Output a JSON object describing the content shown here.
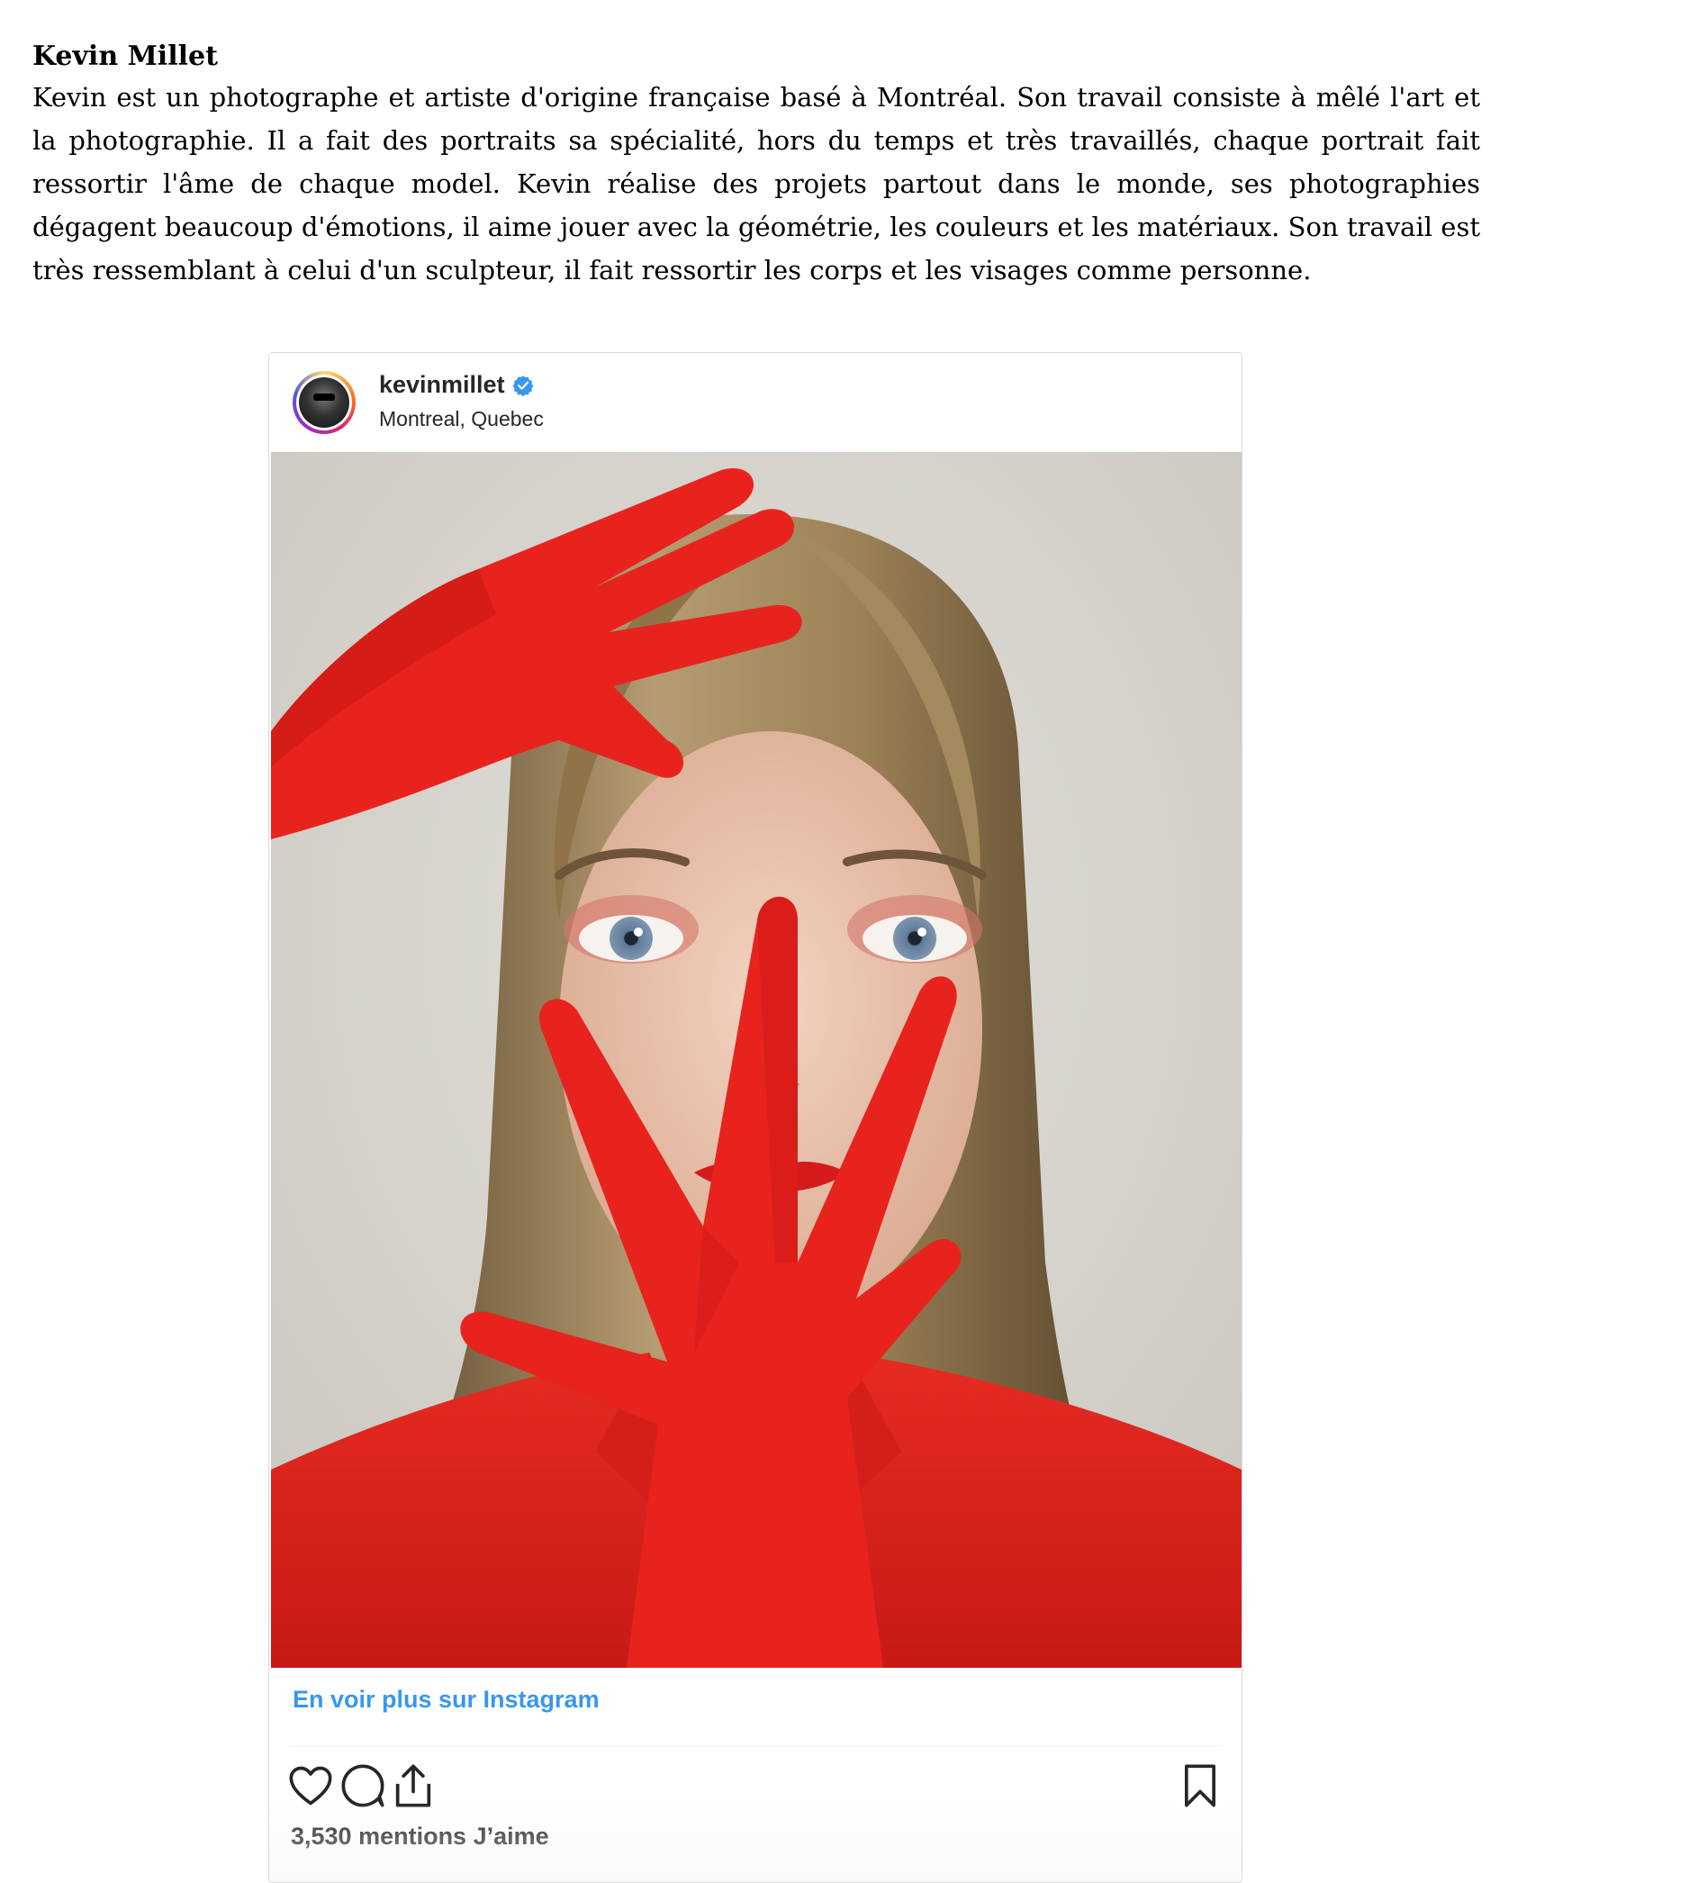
{
  "article": {
    "title": "Kevin Millet",
    "body": "Kevin est un photographe et artiste d'origine française basé à Montréal. Son travail consiste à mêlé l'art et la photographie. Il a fait des portraits sa spécialité, hors du temps et très travaillés, chaque portrait fait ressortir l'âme de chaque model. Kevin réalise des projets partout dans le monde, ses photographies dégagent beaucoup d'émotions, il aime jouer avec la géométrie, les couleurs et les matériaux. Son travail est très ressemblant à celui d'un sculpteur, il fait ressortir les corps et les visages comme personne."
  },
  "instagram": {
    "username": "kevinmillet",
    "location": "Montreal, Quebec",
    "verified_icon": "verified-badge-icon",
    "avatar_icon": "profile-avatar",
    "photo_icon": "portrait-photo",
    "more_link": "En voir plus sur Instagram",
    "likes": "3,530 mentions J’aime",
    "actions": [
      "heart-icon",
      "comment-icon",
      "share-icon",
      "bookmark-icon"
    ],
    "colors": {
      "link": "#3897f0",
      "text": "#262626",
      "verified": "#3897f0",
      "glove_red": "#e8231e"
    }
  }
}
